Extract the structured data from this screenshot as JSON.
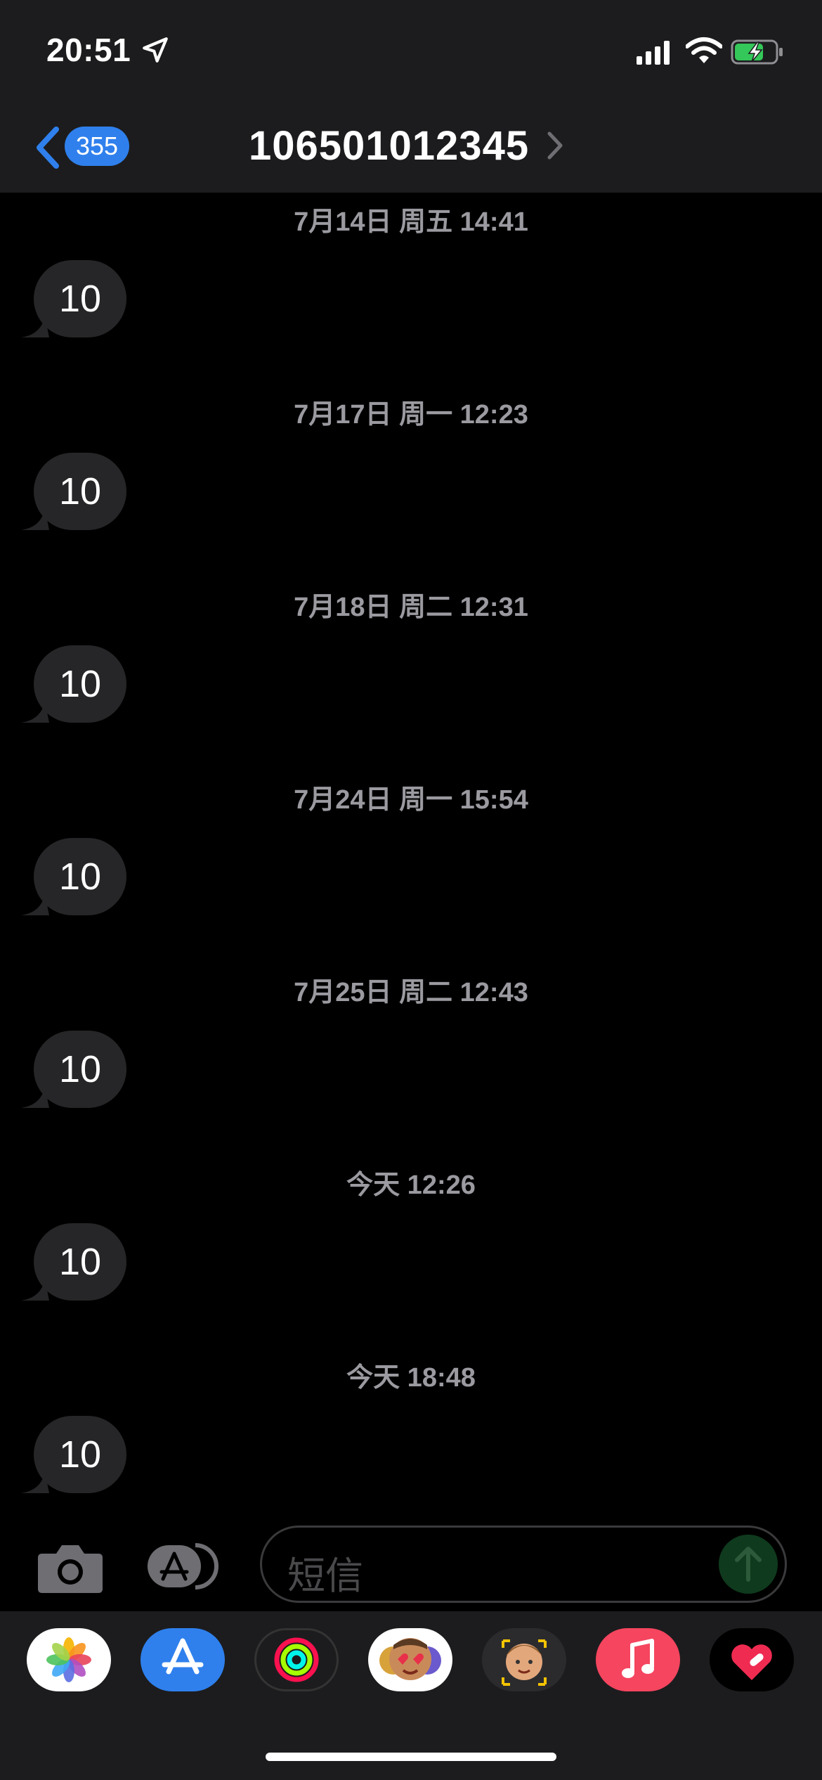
{
  "status_bar": {
    "time": "20:51"
  },
  "header": {
    "back_count": "355",
    "contact": "106501012345"
  },
  "messages": [
    {
      "timestamp": "7月14日 周五 14:41",
      "text": "10"
    },
    {
      "timestamp": "7月17日 周一 12:23",
      "text": "10"
    },
    {
      "timestamp": "7月18日 周二 12:31",
      "text": "10"
    },
    {
      "timestamp": "7月24日 周一 15:54",
      "text": "10"
    },
    {
      "timestamp": "7月25日 周二 12:43",
      "text": "10"
    },
    {
      "timestamp": "今天 12:26",
      "text": "10"
    },
    {
      "timestamp": "今天 18:48",
      "text": "10"
    }
  ],
  "input": {
    "placeholder": "短信"
  },
  "drawer_apps": [
    "photos-icon",
    "app-store-icon",
    "activity-icon",
    "animoji-icon",
    "memoji-icon",
    "music-icon",
    "heart-sticker-icon"
  ],
  "colors": {
    "accent": "#2f80ed",
    "bubble": "#262628",
    "send": "#0f3a1d"
  }
}
